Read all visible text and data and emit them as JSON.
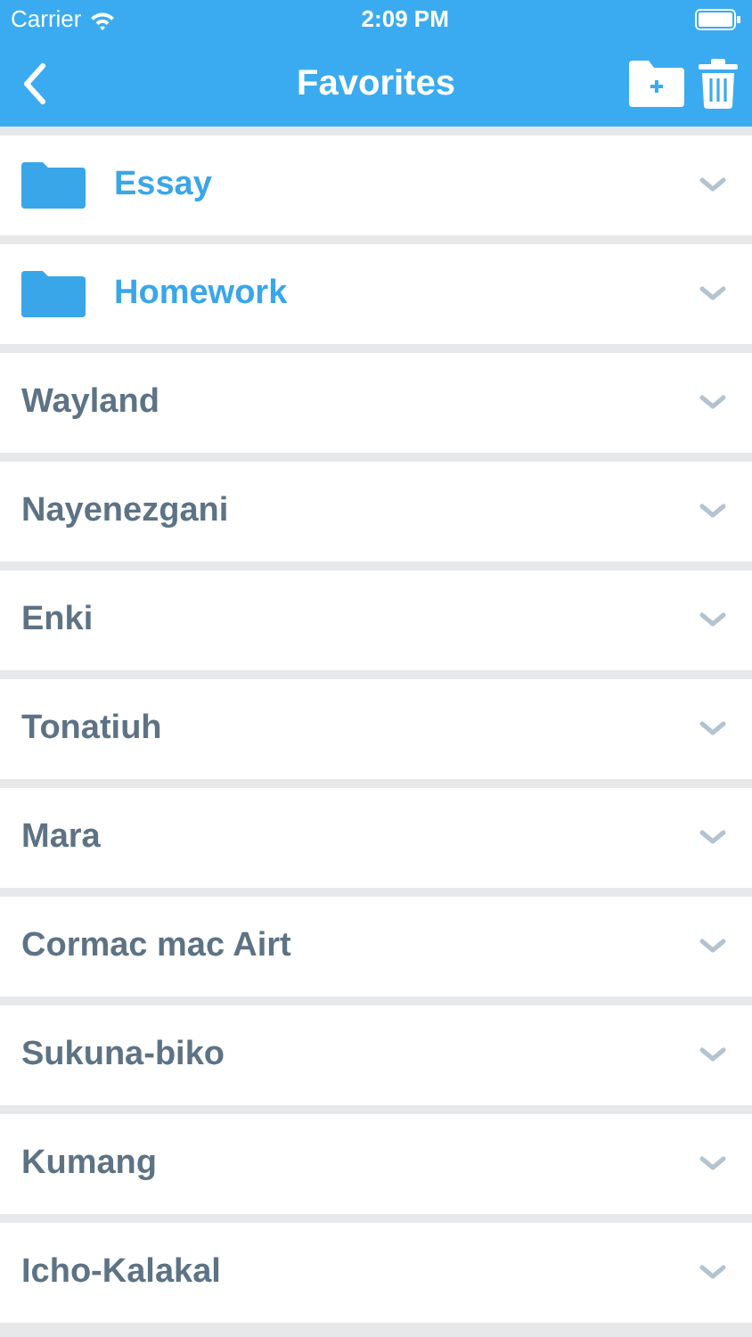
{
  "status_bar": {
    "carrier": "Carrier",
    "time": "2:09 PM"
  },
  "nav": {
    "title": "Favorites"
  },
  "items": [
    {
      "kind": "folder",
      "label": "Essay"
    },
    {
      "kind": "folder",
      "label": "Homework"
    },
    {
      "kind": "entry",
      "label": "Wayland"
    },
    {
      "kind": "entry",
      "label": "Nayenezgani"
    },
    {
      "kind": "entry",
      "label": "Enki"
    },
    {
      "kind": "entry",
      "label": "Tonatiuh"
    },
    {
      "kind": "entry",
      "label": "Mara"
    },
    {
      "kind": "entry",
      "label": "Cormac mac Airt"
    },
    {
      "kind": "entry",
      "label": "Sukuna-biko"
    },
    {
      "kind": "entry",
      "label": "Kumang"
    },
    {
      "kind": "entry",
      "label": "Icho-Kalakal"
    }
  ]
}
